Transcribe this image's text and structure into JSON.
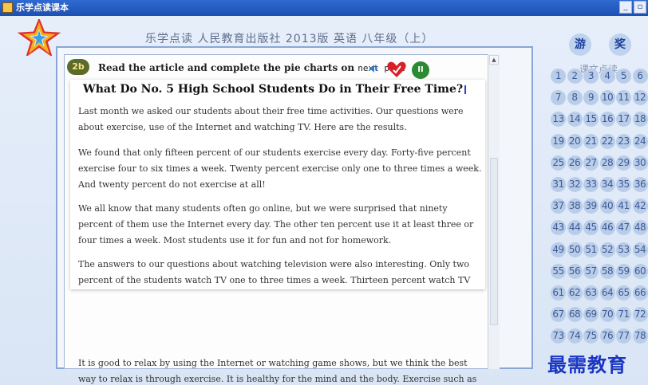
{
  "window": {
    "title": "乐学点读课本"
  },
  "header": {
    "title": "乐学点读  人民教育出版社  2013版  英语  八年级（上）",
    "game_button": "游",
    "reward_button": "奖"
  },
  "sidebar": {
    "label": "课文点读",
    "lessons": [
      [
        "1",
        "2",
        "3",
        "4",
        "5",
        "6"
      ],
      [
        "7",
        "8",
        "9",
        "10",
        "11",
        "12"
      ],
      [
        "13",
        "14",
        "15",
        "16",
        "17",
        "18"
      ],
      [
        "19",
        "20",
        "21",
        "22",
        "23",
        "24"
      ],
      [
        "25",
        "26",
        "27",
        "28",
        "29",
        "30"
      ],
      [
        "31",
        "32",
        "33",
        "34",
        "35",
        "36"
      ],
      [
        "37",
        "38",
        "39",
        "40",
        "41",
        "42"
      ],
      [
        "43",
        "44",
        "45",
        "46",
        "47",
        "48"
      ],
      [
        "49",
        "50",
        "51",
        "52",
        "53",
        "54"
      ],
      [
        "55",
        "56",
        "57",
        "58",
        "59",
        "60"
      ],
      [
        "61",
        "62",
        "63",
        "64",
        "65",
        "66"
      ],
      [
        "67",
        "68",
        "69",
        "70",
        "71",
        "72"
      ],
      [
        "73",
        "74",
        "75",
        "76",
        "77",
        "78"
      ]
    ]
  },
  "content": {
    "exercise_number": "2b",
    "instruction_main": "Read the article and complete the pie charts on ",
    "instruction_mono": "next page",
    "pause_label": "II",
    "article_title": "What Do No. 5 High School Students Do in Their Free Time?",
    "paragraphs": [
      "Last month we asked our students about their free time activities. Our questions were about exercise, use of the Internet and watching TV. Here are the results.",
      "We found that only fifteen percent of our students exercise every day. Forty-five percent exercise four to six times a week. Twenty percent exercise only one to three times a week. And twenty percent do not exercise at all!",
      "We all know that many students often go online, but we were surprised that ninety percent of them use the Internet every day. The other ten percent use it at least three or four times a week. Most students use it for fun and not for homework.",
      "The answers to our questions about watching television were also interesting. Only two percent of the students watch TV one to three times a week. Thirteen percent watch TV four to six times a week. And eighty-five percent watch TV every day! Although many students like to watch sports, game shows are the most popular.",
      "It is good to relax by using the Internet or watching game shows, but we think the best way to relax is through exercise. It is healthy for the mind and the body. Exercise such as"
    ]
  },
  "watermark": "最需教育",
  "colors": {
    "titlebar": "#2f6ad0",
    "panel_border": "#8aa6d6",
    "lesson_bubble": "#b9cde9",
    "watermark": "#1b36c2"
  }
}
